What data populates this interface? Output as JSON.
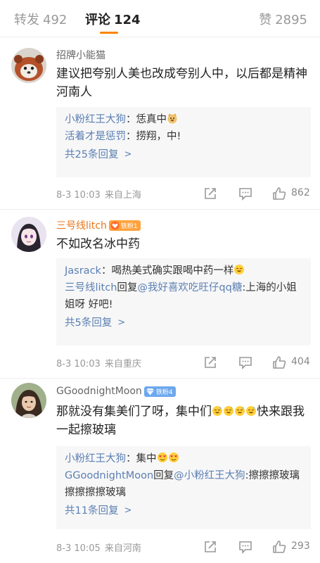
{
  "tabs": {
    "repost": {
      "label": "转发",
      "count": "492"
    },
    "comment": {
      "label": "评论",
      "count": "124"
    },
    "like": {
      "label": "赞",
      "count": "2895"
    }
  },
  "comments": [
    {
      "username": "招牌小能猫",
      "text": "建议把夸别人美也改成夸别人中，以后都是精神河南人",
      "replies": [
        {
          "name": "小粉红王大狗",
          "sep": "：",
          "text": "恁真中"
        },
        {
          "name": "活着才是惩罚",
          "sep": "：",
          "text": "捞翔，中!"
        }
      ],
      "more": "共25条回复",
      "date": "8-3 10:03",
      "location": "来自上海",
      "likes": "862"
    },
    {
      "username": "三号线litch",
      "badge": "铁粉1",
      "text": "不如改名冰中药",
      "replies": [
        {
          "name": "Jasrack",
          "sep": "：",
          "text": "喝热美式确实跟喝中药一样"
        },
        {
          "name": "三号线litch",
          "mid": "回复",
          "mention": "@我好喜欢吃旺仔qq糖",
          "text": ":上海的小姐姐呀  好吧!"
        }
      ],
      "more": "共5条回复",
      "date": "8-3 10:03",
      "location": "来自重庆",
      "likes": "404"
    },
    {
      "username": "GGoodnightMoon",
      "badge": "铁粉4",
      "text_before": "那就没有集美们了呀，集中们",
      "text_after": "快来跟我一起擦玻璃",
      "replies": [
        {
          "name": "小粉红王大狗",
          "sep": "：",
          "text": "集中"
        },
        {
          "name": "GGoodnightMoon",
          "mid": "回复",
          "mention": "@小粉红王大狗",
          "text": ":擦擦擦玻璃擦擦擦擦玻璃"
        }
      ],
      "more": "共11条回复",
      "date": "8-3 10:05",
      "location": "来自河南",
      "likes": "293"
    }
  ],
  "icons": {
    "share": "share-icon",
    "reply": "comment-icon",
    "like": "thumbs-up-icon",
    "chevron": "chevron-right-icon"
  },
  "colors": {
    "accent": "#ff8200",
    "link": "#5b7fb3",
    "fan_gold": "#ffa23c",
    "fan_blue": "#6da8ee",
    "reply_bg": "#f7f7f7"
  }
}
